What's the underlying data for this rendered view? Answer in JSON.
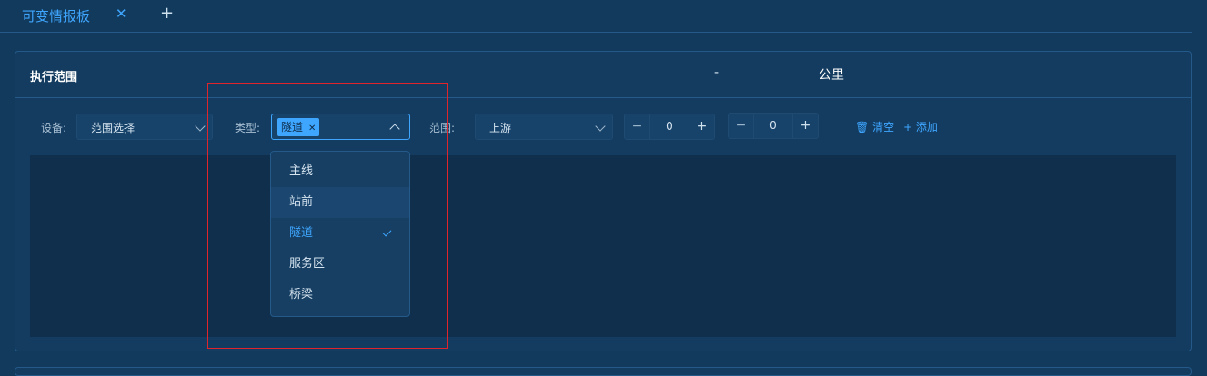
{
  "tabs": {
    "active_label": "可变情报板",
    "close_icon": "close-icon",
    "add_icon": "plus-icon"
  },
  "panel": {
    "title": "执行范围"
  },
  "filters": {
    "device_label": "设备:",
    "device_value": "范围选择",
    "type_label": "类型:",
    "type_tag": "隧道",
    "range_label": "范围:",
    "range_value": "上游",
    "from_value": "0",
    "to_value": "0",
    "dash": "-",
    "unit": "公里",
    "minus_symbol": "−",
    "plus_symbol": "+",
    "clear_label": "清空",
    "add_label": "添加"
  },
  "dropdown": {
    "options": [
      {
        "label": "主线",
        "state": "normal"
      },
      {
        "label": "站前",
        "state": "hover"
      },
      {
        "label": "隧道",
        "state": "selected"
      },
      {
        "label": "服务区",
        "state": "normal"
      },
      {
        "label": "桥梁",
        "state": "normal"
      }
    ]
  },
  "colors": {
    "accent": "#3fa6ff",
    "background": "#123a5c",
    "highlight_border": "#e0242c"
  }
}
